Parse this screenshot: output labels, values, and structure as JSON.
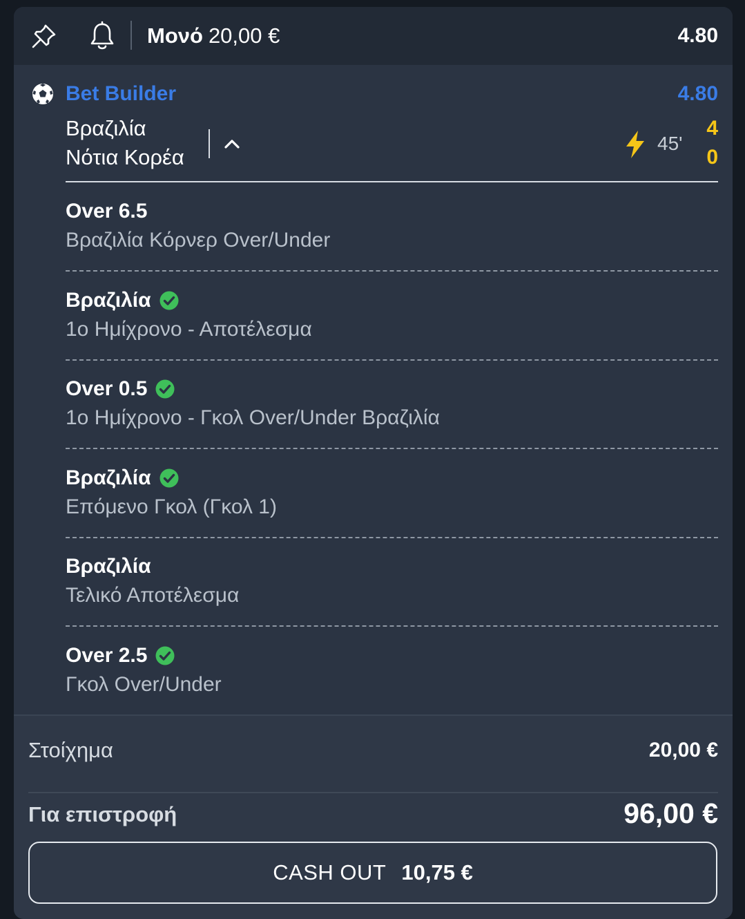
{
  "header": {
    "bet_type": "Μονό",
    "stake": "20,00 €",
    "odds": "4.80",
    "pin_icon": "pin-icon",
    "bell_icon": "bell-icon"
  },
  "builder": {
    "title": "Bet Builder",
    "odds": "4.80",
    "sport_icon": "soccer-ball-icon",
    "accent_color": "#3a7ce6"
  },
  "match": {
    "home_team": "Βραζιλία",
    "away_team": "Νότια Κορέα",
    "minute": "45'",
    "home_score": "4",
    "away_score": "0",
    "live_icon": "lightning-icon",
    "score_color": "#f5c518"
  },
  "selections": [
    {
      "title": "Over 6.5",
      "market": "Βραζιλία Κόρνερ Over/Under",
      "won": false
    },
    {
      "title": "Βραζιλία",
      "market": "1ο Ημίχρονο - Αποτέλεσμα",
      "won": true
    },
    {
      "title": "Over 0.5",
      "market": "1ο Ημίχρονο - Γκολ Over/Under Βραζιλία",
      "won": true
    },
    {
      "title": "Βραζιλία",
      "market": "Επόμενο Γκολ (Γκολ 1)",
      "won": true
    },
    {
      "title": "Βραζιλία",
      "market": "Τελικό Αποτέλεσμα",
      "won": false
    },
    {
      "title": "Over 2.5",
      "market": "Γκολ Over/Under",
      "won": true
    }
  ],
  "summary": {
    "stake_label": "Στοίχημα",
    "stake_value": "20,00 €",
    "return_label": "Για επιστροφή",
    "return_value": "96,00 €"
  },
  "cashout": {
    "label": "CASH OUT",
    "amount": "10,75 €"
  },
  "colors": {
    "won_check": "#3fbf5a"
  }
}
